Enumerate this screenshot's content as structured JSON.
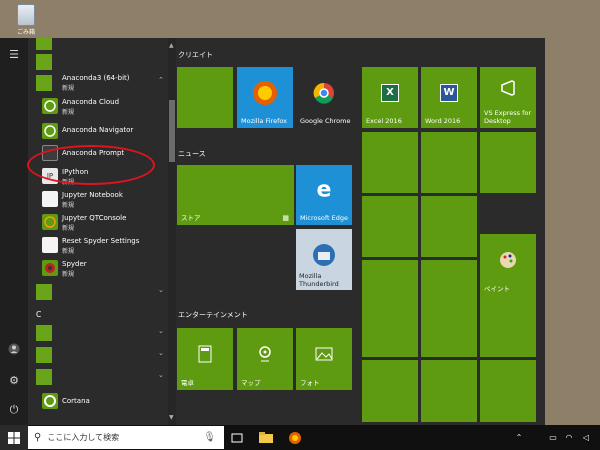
{
  "desktop": {
    "recycle_label": "ごみ箱"
  },
  "applist": {
    "items": [
      {
        "label": "Anaconda3 (64-bit)",
        "sub": "新規"
      },
      {
        "label": "Anaconda Cloud",
        "sub": "新規"
      },
      {
        "label": "Anaconda Navigator",
        "sub": ""
      },
      {
        "label": "Anaconda Prompt",
        "sub": ""
      },
      {
        "label": "IPython",
        "sub": "新規"
      },
      {
        "label": "Jupyter Notebook",
        "sub": "新規"
      },
      {
        "label": "Jupyter QTConsole",
        "sub": "新規"
      },
      {
        "label": "Reset Spyder Settings",
        "sub": "新規"
      },
      {
        "label": "Spyder",
        "sub": "新規"
      },
      {
        "label": "Cortana",
        "sub": ""
      }
    ],
    "section_c": "C"
  },
  "groups": {
    "creative": "クリエイト",
    "news": "ニュース",
    "entertainment": "エンターテインメント"
  },
  "tiles": {
    "firefox": "Mozilla Firefox",
    "chrome": "Google Chrome",
    "excel": "Excel 2016",
    "word": "Word 2016",
    "vs": "VS Express for Desktop",
    "store": "ストア",
    "edge": "Microsoft Edge",
    "thunderbird": "Mozilla Thunderbird",
    "paint": "ペイント",
    "calc": "電卓",
    "maps": "マップ",
    "photos": "フォト"
  },
  "taskbar": {
    "search_placeholder": "ここに入力して検索"
  },
  "colors": {
    "tile_green": "#5f9b11",
    "start_bg": "#2b2b2b",
    "highlight_circle": "#e0141c"
  }
}
